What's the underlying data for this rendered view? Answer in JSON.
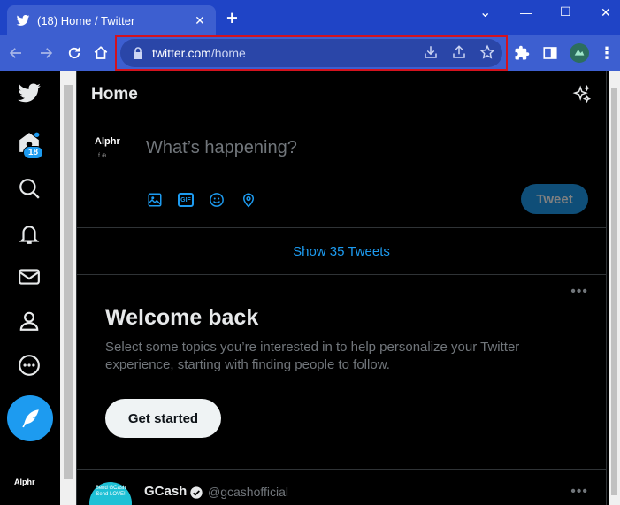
{
  "browser": {
    "tab_title": "(18) Home / Twitter",
    "tab_close": "✕",
    "new_tab": "+",
    "url_host": "twitter.com",
    "url_path": "/home",
    "window_controls": {
      "minimize": "—",
      "maximize": "☐",
      "close": "✕"
    },
    "caret": "⌄",
    "menu": "⋮"
  },
  "nav": {
    "notifications_count": "18",
    "brand": "Alphr"
  },
  "main": {
    "title": "Home",
    "compose": {
      "brand": "Alphr",
      "brand_sub": "f  ⊕",
      "placeholder": "What’s happening?",
      "tweet_label": "Tweet",
      "gif_label": "GIF"
    },
    "show_tweets": "Show 35 Tweets",
    "welcome": {
      "title": "Welcome back",
      "text": "Select some topics you’re interested in to help personalize your Twitter experience, starting with finding people to follow.",
      "button": "Get started",
      "more": "•••"
    },
    "tweet": {
      "name": "GCash",
      "handle": "@gcashofficial",
      "avatar_text": "Send GCash Send LOVE!",
      "more": "•••"
    }
  },
  "colors": {
    "accent": "#1d9bf0",
    "chrome": "#1f44c6",
    "highlight": "#d4121e"
  }
}
